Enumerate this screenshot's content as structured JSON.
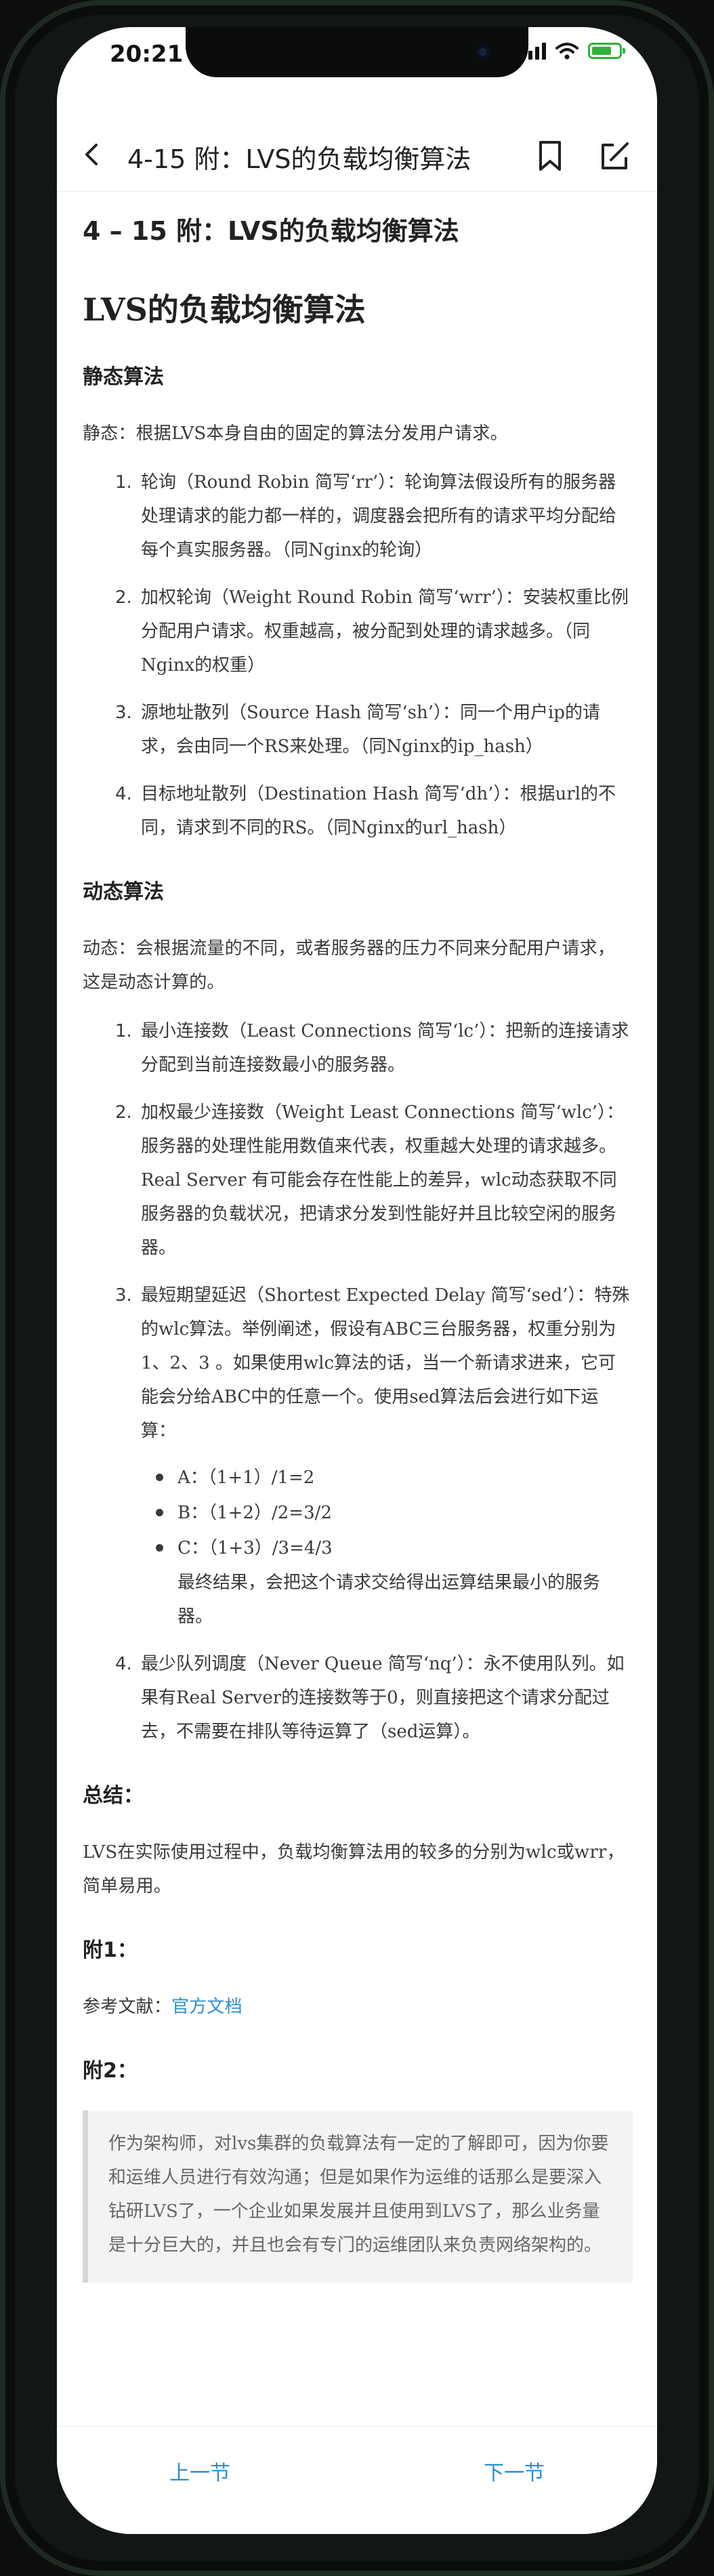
{
  "status_bar": {
    "time": "20:21"
  },
  "nav": {
    "title": "4-15 附：LVS的负载均衡算法"
  },
  "article": {
    "page_heading": "4 – 15 附：LVS的负载均衡算法",
    "main_heading": "LVS的负载均衡算法",
    "static": {
      "heading": "静态算法",
      "intro": "静态：根据LVS本身自由的固定的算法分发用户请求。",
      "items": [
        "轮询（Round Robin 简写‘rr’）：轮询算法假设所有的服务器处理请求的能力都一样的，调度器会把所有的请求平均分配给每个真实服务器。（同Nginx的轮询）",
        "加权轮询（Weight Round Robin 简写‘wrr’）：安装权重比例分配用户请求。权重越高，被分配到处理的请求越多。（同Nginx的权重）",
        "源地址散列（Source Hash 简写‘sh’）：同一个用户ip的请求，会由同一个RS来处理。（同Nginx的ip_hash）",
        "目标地址散列（Destination Hash 简写‘dh’）：根据url的不同，请求到不同的RS。（同Nginx的url_hash）"
      ]
    },
    "dynamic": {
      "heading": "动态算法",
      "intro": "动态：会根据流量的不同，或者服务器的压力不同来分配用户请求，这是动态计算的。",
      "items": [
        "最小连接数（Least Connections 简写‘lc’）：把新的连接请求分配到当前连接数最小的服务器。",
        "加权最少连接数（Weight Least Connections 简写‘wlc’）：服务器的处理性能用数值来代表，权重越大处理的请求越多。Real Server 有可能会存在性能上的差异，wlc动态获取不同服务器的负载状况，把请求分发到性能好并且比较空闲的服务器。",
        "最短期望延迟（Shortest Expected Delay 简写‘sed’）：特殊的wlc算法。举例阐述，假设有ABC三台服务器，权重分别为1、2、3 。如果使用wlc算法的话，当一个新请求进来，它可能会分给ABC中的任意一个。使用sed算法后会进行如下运算：",
        "最少队列调度（Never Queue 简写‘nq’）：永不使用队列。如果有Real Server的连接数等于0，则直接把这个请求分配过去，不需要在排队等待运算了（sed运算）。"
      ],
      "sed_calc": [
        "A：（1+1）/1=2",
        "B：（1+2）/2=3/2",
        "C：（1+3）/3=4/3"
      ],
      "sed_note": "最终结果，会把这个请求交给得出运算结果最小的服务器。"
    },
    "summary": {
      "heading": "总结：",
      "text": "LVS在实际使用过程中，负载均衡算法用的较多的分别为wlc或wrr，简单易用。"
    },
    "appendix1": {
      "heading": "附1：",
      "ref_label": "参考文献：",
      "ref_link": "官方文档"
    },
    "appendix2": {
      "heading": "附2：",
      "quote": "作为架构师，对lvs集群的负载算法有一定的了解即可，因为你要和运维人员进行有效沟通；但是如果作为运维的话那么是要深入钻研LVS了，一个企业如果发展并且使用到LVS了，那么业务量是十分巨大的，并且也会有专门的运维团队来负责网络架构的。"
    }
  },
  "footer": {
    "prev": "上一节",
    "next": "下一节"
  },
  "colors": {
    "link": "#2a8fd0",
    "battery": "#2fb23a",
    "frame": "#121714"
  },
  "icons": [
    "back-arrow-icon",
    "bookmark-icon",
    "edit-icon",
    "signal-icon",
    "wifi-icon",
    "battery-icon"
  ]
}
